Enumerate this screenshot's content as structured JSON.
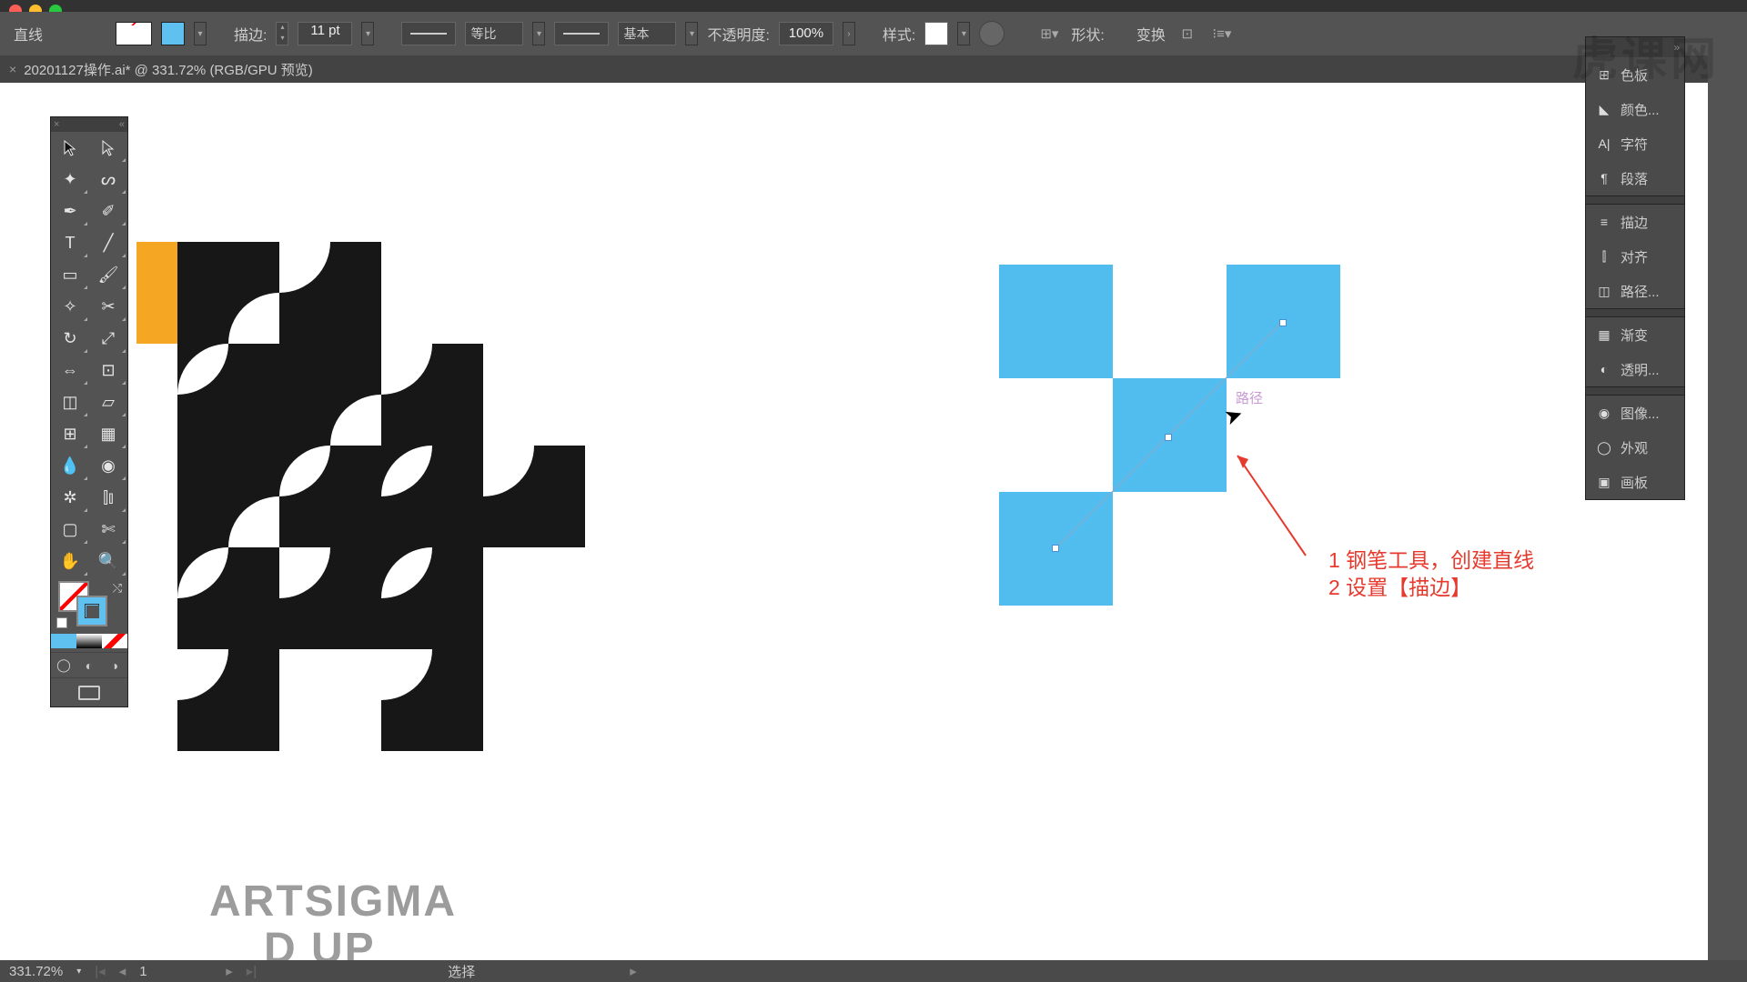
{
  "control_bar": {
    "tool_name": "直线",
    "stroke_label": "描边:",
    "stroke_weight": "11 pt",
    "profile_label": "等比",
    "brush_label": "基本",
    "opacity_label": "不透明度:",
    "opacity_value": "100%",
    "style_label": "样式:",
    "shape_label": "形状:",
    "transform_label": "变换"
  },
  "tab": {
    "title": "20201127操作.ai* @ 331.72% (RGB/GPU 预览)"
  },
  "right_panel": {
    "items": [
      {
        "icon": "swatch",
        "label": "色板"
      },
      {
        "icon": "color",
        "label": "颜色..."
      },
      {
        "icon": "char",
        "label": "字符"
      },
      {
        "icon": "para",
        "label": "段落"
      }
    ],
    "items2": [
      {
        "icon": "stroke",
        "label": "描边"
      },
      {
        "icon": "align",
        "label": "对齐"
      },
      {
        "icon": "path",
        "label": "路径..."
      }
    ],
    "items3": [
      {
        "icon": "grad",
        "label": "渐变"
      },
      {
        "icon": "trans",
        "label": "透明..."
      }
    ],
    "items4": [
      {
        "icon": "img",
        "label": "图像..."
      },
      {
        "icon": "appear",
        "label": "外观"
      },
      {
        "icon": "artboard",
        "label": "画板"
      }
    ]
  },
  "canvas": {
    "bottom_text_1": "ARTSIGMA",
    "bottom_text_2": "D UP",
    "annotation_1": "1 钢笔工具，创建直线",
    "annotation_2": "2 设置【描边】",
    "path_label": "路径"
  },
  "status": {
    "zoom": "331.72%",
    "artboard": "1",
    "tool_status": "选择"
  },
  "watermark": "虎课网"
}
